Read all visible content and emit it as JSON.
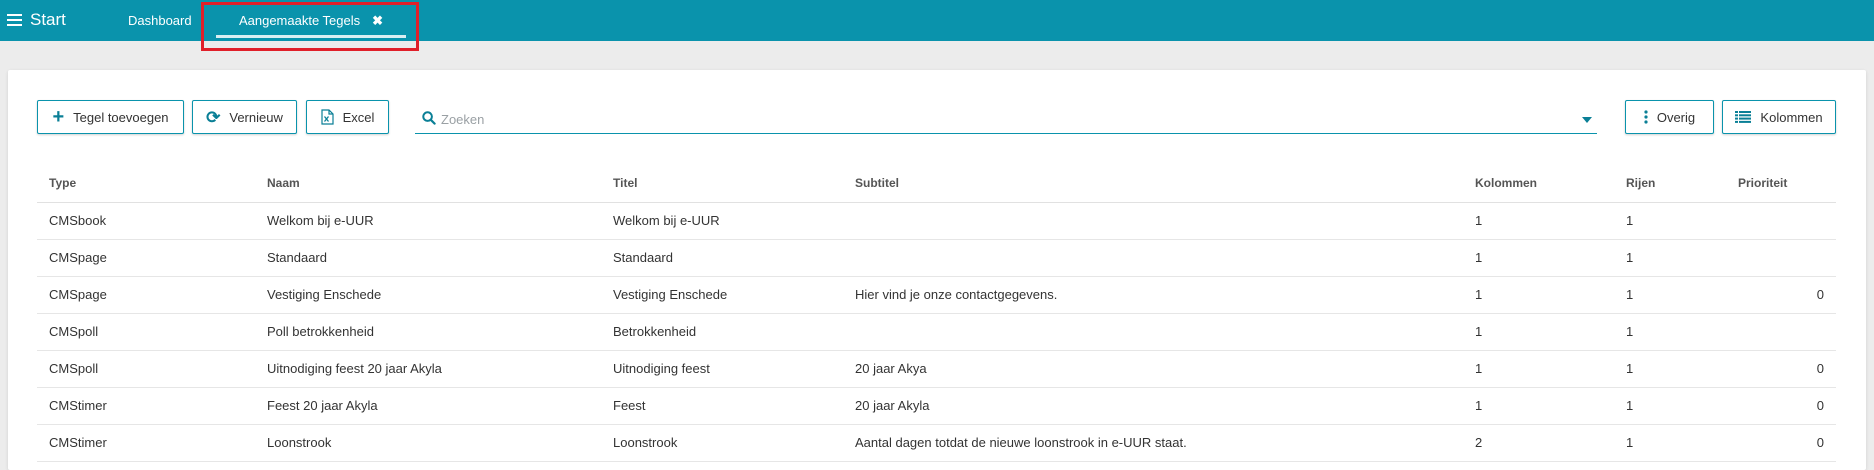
{
  "topbar": {
    "start_label": "Start",
    "tabs": [
      {
        "label": "Dashboard"
      },
      {
        "label": "Aangemaakte Tegels",
        "close": "✖"
      }
    ]
  },
  "toolbar": {
    "add_label": "Tegel toevoegen",
    "refresh_label": "Vernieuw",
    "excel_label": "Excel",
    "overig_label": "Overig",
    "kolommen_label": "Kolommen"
  },
  "search": {
    "placeholder": "Zoeken",
    "value": ""
  },
  "colors": {
    "accent": "#0a93ac",
    "highlight": "#e0202a"
  },
  "table": {
    "headers": [
      "Type",
      "Naam",
      "Titel",
      "Subtitel",
      "Kolommen",
      "Rijen",
      "Prioriteit"
    ],
    "rows": [
      [
        "CMSbook",
        "Welkom bij e-UUR",
        "Welkom bij e-UUR",
        "",
        "1",
        "1",
        ""
      ],
      [
        "CMSpage",
        "Standaard",
        "Standaard",
        "",
        "1",
        "1",
        ""
      ],
      [
        "CMSpage",
        "Vestiging Enschede",
        "Vestiging Enschede",
        "Hier vind je onze contactgegevens.",
        "1",
        "1",
        "0"
      ],
      [
        "CMSpoll",
        "Poll betrokkenheid",
        "Betrokkenheid",
        "",
        "1",
        "1",
        ""
      ],
      [
        "CMSpoll",
        "Uitnodiging feest 20 jaar Akyla",
        "Uitnodiging feest",
        "20 jaar Akya",
        "1",
        "1",
        "0"
      ],
      [
        "CMStimer",
        "Feest 20 jaar Akyla",
        "Feest",
        "20 jaar Akyla",
        "1",
        "1",
        "0"
      ],
      [
        "CMStimer",
        "Loonstrook",
        "Loonstrook",
        "Aantal dagen totdat de nieuwe loonstrook in e-UUR staat.",
        "2",
        "1",
        "0"
      ]
    ]
  }
}
